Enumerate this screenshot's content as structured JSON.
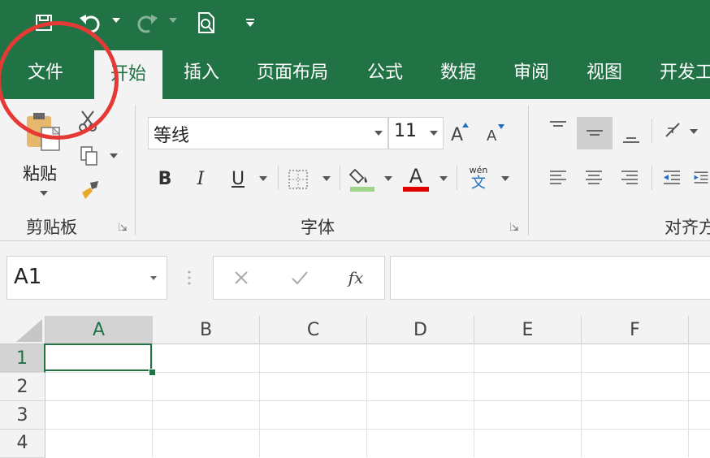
{
  "tabs": {
    "file": "文件",
    "home": "开始",
    "insert": "插入",
    "page_layout": "页面布局",
    "formulas": "公式",
    "data": "数据",
    "review": "审阅",
    "view": "视图",
    "developer": "开发工"
  },
  "ribbon": {
    "paste_label": "粘贴",
    "clipboard_group": "剪贴板",
    "font_name": "等线",
    "font_size": "11",
    "font_group": "字体",
    "alignment_group": "对齐方",
    "bold": "B",
    "italic": "I",
    "underline": "U",
    "font_color_glyph": "A",
    "phonetic_top": "wén",
    "phonetic_bottom": "文"
  },
  "formula_bar": {
    "name_box": "A1",
    "fx": "fx",
    "value": ""
  },
  "sheet": {
    "columns": [
      "A",
      "B",
      "C",
      "D",
      "E",
      "F"
    ],
    "rows": [
      "1",
      "2",
      "3",
      "4"
    ],
    "selected_cell": "A1"
  },
  "colors": {
    "accent": "#217346",
    "annotation_circle": "#e53935",
    "fill_color_bar": "#9fd48a",
    "font_color_bar": "#e00000"
  }
}
